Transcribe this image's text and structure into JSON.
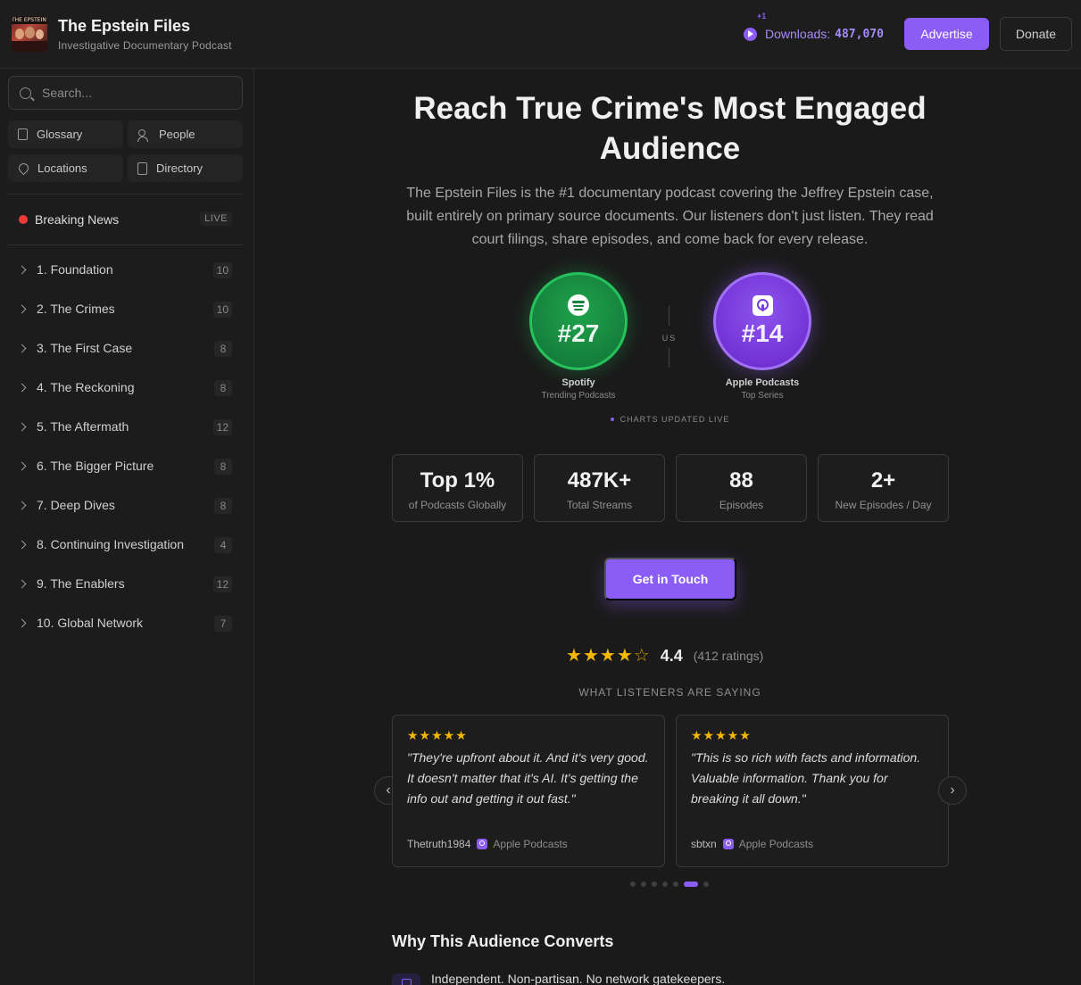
{
  "header": {
    "title": "The Epstein Files",
    "subtitle": "Investigative Documentary Podcast",
    "logo_text": "THE EPSTEIN FILES",
    "downloads_increment": "+1",
    "downloads_label": "Downloads:",
    "downloads_value": "487,070",
    "advertise_label": "Advertise",
    "donate_label": "Donate"
  },
  "sidebar": {
    "search_placeholder": "Search...",
    "quick_links": [
      {
        "label": "Glossary",
        "icon": "book-icon"
      },
      {
        "label": "People",
        "icon": "people-icon"
      },
      {
        "label": "Locations",
        "icon": "map-pin-icon"
      },
      {
        "label": "Directory",
        "icon": "document-icon"
      }
    ],
    "breaking": {
      "label": "Breaking News",
      "badge": "LIVE"
    },
    "sections": [
      {
        "label": "1. Foundation",
        "count": "10"
      },
      {
        "label": "2. The Crimes",
        "count": "10"
      },
      {
        "label": "3. The First Case",
        "count": "8"
      },
      {
        "label": "4. The Reckoning",
        "count": "8"
      },
      {
        "label": "5. The Aftermath",
        "count": "12"
      },
      {
        "label": "6. The Bigger Picture",
        "count": "8"
      },
      {
        "label": "7. Deep Dives",
        "count": "8"
      },
      {
        "label": "8. Continuing Investigation",
        "count": "4"
      },
      {
        "label": "9. The Enablers",
        "count": "12"
      },
      {
        "label": "10. Global Network",
        "count": "7"
      }
    ]
  },
  "hero": {
    "title": "Reach True Crime's Most Engaged Audience",
    "description": "The Epstein Files is the #1 documentary podcast covering the Jeffrey Epstein case, built entirely on primary source documents. Our listeners don't just listen. They read court filings, share episodes, and come back for every release."
  },
  "rankings": {
    "vs_label": "US",
    "spotify": {
      "rank": "#27",
      "platform": "Spotify",
      "category": "Trending Podcasts",
      "color": "#15803d"
    },
    "apple": {
      "rank": "#14",
      "platform": "Apple Podcasts",
      "category": "Top Series",
      "color": "#7c3aed"
    },
    "charts_note": "CHARTS UPDATED LIVE"
  },
  "stats": [
    {
      "value": "Top 1%",
      "label": "of Podcasts Globally"
    },
    {
      "value": "487K+",
      "label": "Total Streams"
    },
    {
      "value": "88",
      "label": "Episodes"
    },
    {
      "value": "2+",
      "label": "New Episodes / Day"
    }
  ],
  "cta": {
    "label": "Get in Touch"
  },
  "rating": {
    "score": "4.4",
    "count_text": "(412 ratings)",
    "stars": 4.4
  },
  "reviews": {
    "heading": "WHAT LISTENERS ARE SAYING",
    "items": [
      {
        "stars": "★★★★★",
        "quote": "\"They're upfront about it. And it's very good. It doesn't matter that it's AI. It's getting the info out and getting it out fast.\"",
        "author": "Thetruth1984",
        "source": "Apple Podcasts"
      },
      {
        "stars": "★★★★★",
        "quote": "\"This is so rich with facts and information. Valuable information. Thank you for breaking it all down.\"",
        "author": "sbtxn",
        "source": "Apple Podcasts"
      }
    ],
    "prev_label": "‹",
    "next_label": "›",
    "total_pages": 7,
    "active_page": 6
  },
  "why": {
    "heading": "Why This Audience Converts",
    "items": [
      {
        "text": "Independent. Non-partisan. No network gatekeepers.",
        "icon": "shield-icon"
      }
    ]
  },
  "colors": {
    "accent": "#8b5cf6",
    "spotify": "#15803d",
    "live": "#ef3a3a",
    "star": "#f5b800"
  }
}
